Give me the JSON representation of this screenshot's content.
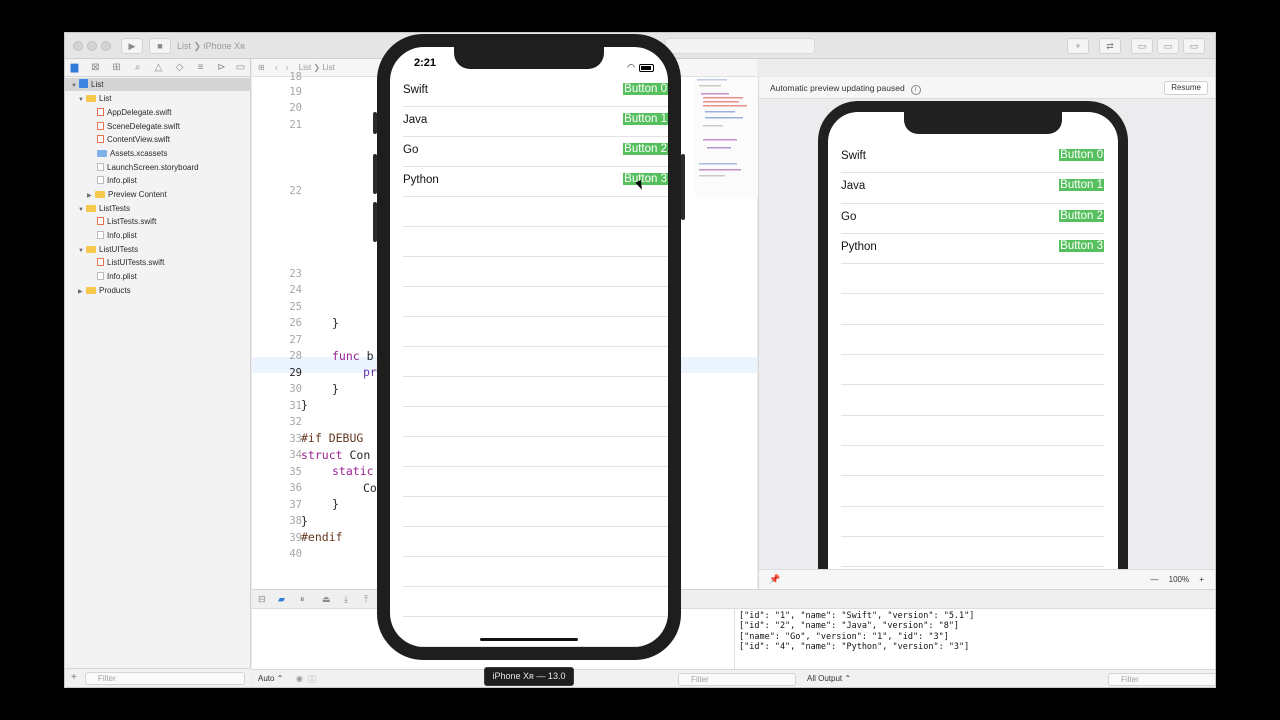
{
  "toolbar": {
    "scheme": "List",
    "device": "iPhone Xʀ"
  },
  "jumpbar": {
    "crumbs": [
      "List",
      "List"
    ]
  },
  "navigator": {
    "items": [
      {
        "label": "List",
        "kind": "project",
        "disclosure": "open"
      },
      {
        "label": "List",
        "kind": "folder",
        "disclosure": "open"
      },
      {
        "label": "AppDelegate.swift",
        "kind": "swift"
      },
      {
        "label": "SceneDelegate.swift",
        "kind": "swift"
      },
      {
        "label": "ContentView.swift",
        "kind": "swift"
      },
      {
        "label": "Assets.xcassets",
        "kind": "assets"
      },
      {
        "label": "LaunchScreen.storyboard",
        "kind": "file"
      },
      {
        "label": "Info.plist",
        "kind": "file"
      },
      {
        "label": "Preview Content",
        "kind": "folder",
        "disclosure": "closed"
      },
      {
        "label": "ListTests",
        "kind": "folder",
        "disclosure": "open"
      },
      {
        "label": "ListTests.swift",
        "kind": "swift"
      },
      {
        "label": "Info.plist",
        "kind": "file"
      },
      {
        "label": "ListUITests",
        "kind": "folder",
        "disclosure": "open"
      },
      {
        "label": "ListUITests.swift",
        "kind": "swift"
      },
      {
        "label": "Info.plist",
        "kind": "file"
      },
      {
        "label": "Products",
        "kind": "folder",
        "disclosure": "closed"
      }
    ],
    "filter_placeholder": "Filter"
  },
  "editor": {
    "line_numbers": [
      "18",
      "19",
      "20",
      "21",
      "22",
      "23",
      "24",
      "25",
      "26",
      "27",
      "28",
      "29",
      "30",
      "31",
      "32",
      "33",
      "34",
      "35",
      "36",
      "37",
      "38",
      "39",
      "40"
    ],
    "active_line": "29",
    "code": {
      "l25": "}",
      "l26": "}",
      "l28_kw": "func",
      "l28_rest": " b",
      "l29": "pr",
      "l30": "}",
      "l31": "}",
      "l33": "#if DEBUG",
      "l34_kw": "struct",
      "l34_rest": " Con",
      "l35_kw": "static",
      "l36": "Co",
      "l37": "}",
      "l38": "}",
      "l39": "#endif"
    }
  },
  "canvas": {
    "status": "Automatic preview updating paused",
    "resume_label": "Resume",
    "zoom": "100%"
  },
  "list_rows": [
    {
      "name": "Swift",
      "button": "Button 0"
    },
    {
      "name": "Java",
      "button": "Button 1"
    },
    {
      "name": "Go",
      "button": "Button 2"
    },
    {
      "name": "Python",
      "button": "Button 3"
    }
  ],
  "simulator": {
    "time": "2:21",
    "device_label": "iPhone Xʀ — 13.0"
  },
  "debug": {
    "auto_label": "Auto ⌃",
    "output_label": "All Output ⌃",
    "filter_placeholder": "Filter",
    "console": [
      "[\"id\": \"1\", \"name\": \"Swift\", \"version\": \"5.1\"]",
      "[\"id\": \"2\", \"name\": \"Java\", \"version\": \"8\"]",
      "[\"name\": \"Go\", \"version\": \"1\", \"id\": \"3\"]",
      "[\"id\": \"4\", \"name\": \"Python\", \"version\": \"3\"]"
    ]
  },
  "colors": {
    "button_green": "#56c05e",
    "selection_blue": "#2e7bd9"
  }
}
